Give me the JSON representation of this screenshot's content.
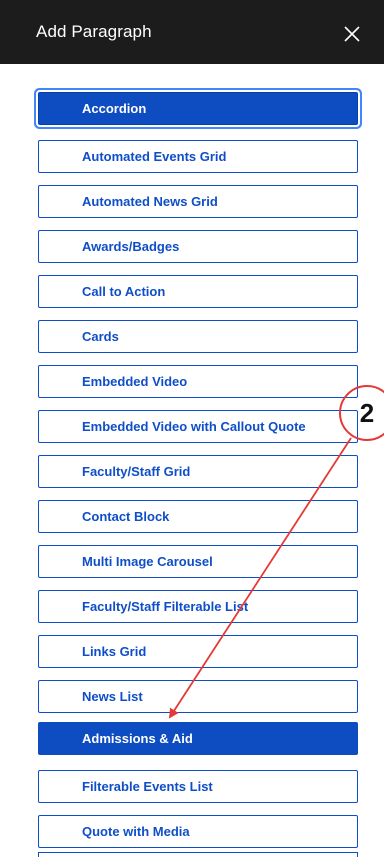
{
  "header": {
    "title": "Add Paragraph",
    "close_icon": "close-icon"
  },
  "items": [
    {
      "label": "Accordion"
    },
    {
      "label": "Automated Events Grid"
    },
    {
      "label": "Automated News Grid"
    },
    {
      "label": "Awards/Badges"
    },
    {
      "label": "Call to Action"
    },
    {
      "label": "Cards"
    },
    {
      "label": "Embedded Video"
    },
    {
      "label": "Embedded Video with Callout Quote"
    },
    {
      "label": "Faculty/Staff Grid"
    },
    {
      "label": "Contact Block"
    },
    {
      "label": "Multi Image Carousel"
    },
    {
      "label": "Faculty/Staff Filterable List"
    },
    {
      "label": "Links Grid"
    },
    {
      "label": "News List"
    },
    {
      "label": "Admissions & Aid"
    },
    {
      "label": "Filterable Events List"
    },
    {
      "label": "Quote with Media"
    }
  ],
  "annotation": {
    "step_number": "2",
    "color": "#e53935"
  },
  "colors": {
    "accent": "#0e4cc2",
    "header_bg": "#1c1c1c"
  }
}
